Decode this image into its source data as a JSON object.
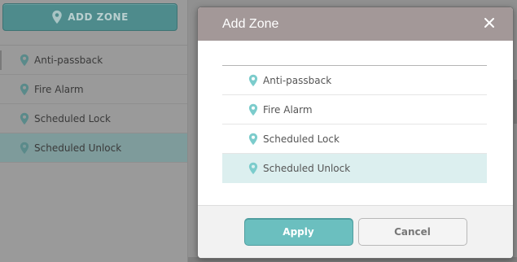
{
  "colors": {
    "accent": "#6bbfbf",
    "pin": "#7ccccc",
    "header": "#a39898",
    "selected_row": "#dcefef"
  },
  "background": {
    "add_zone_label": "ADD ZONE",
    "add_zone_icon": "map-pin-icon",
    "zones": [
      {
        "label": "Anti-passback",
        "icon": "map-pin-icon",
        "selected": false
      },
      {
        "label": "Fire Alarm",
        "icon": "map-pin-icon",
        "selected": false
      },
      {
        "label": "Scheduled Lock",
        "icon": "map-pin-icon",
        "selected": false
      },
      {
        "label": "Scheduled Unlock",
        "icon": "map-pin-icon",
        "selected": true
      }
    ]
  },
  "modal": {
    "title": "Add Zone",
    "close_icon": "close-icon",
    "zones": [
      {
        "label": "Anti-passback",
        "icon": "map-pin-icon",
        "selected": false
      },
      {
        "label": "Fire Alarm",
        "icon": "map-pin-icon",
        "selected": false
      },
      {
        "label": "Scheduled Lock",
        "icon": "map-pin-icon",
        "selected": false
      },
      {
        "label": "Scheduled Unlock",
        "icon": "map-pin-icon",
        "selected": true
      }
    ],
    "apply_label": "Apply",
    "cancel_label": "Cancel"
  }
}
